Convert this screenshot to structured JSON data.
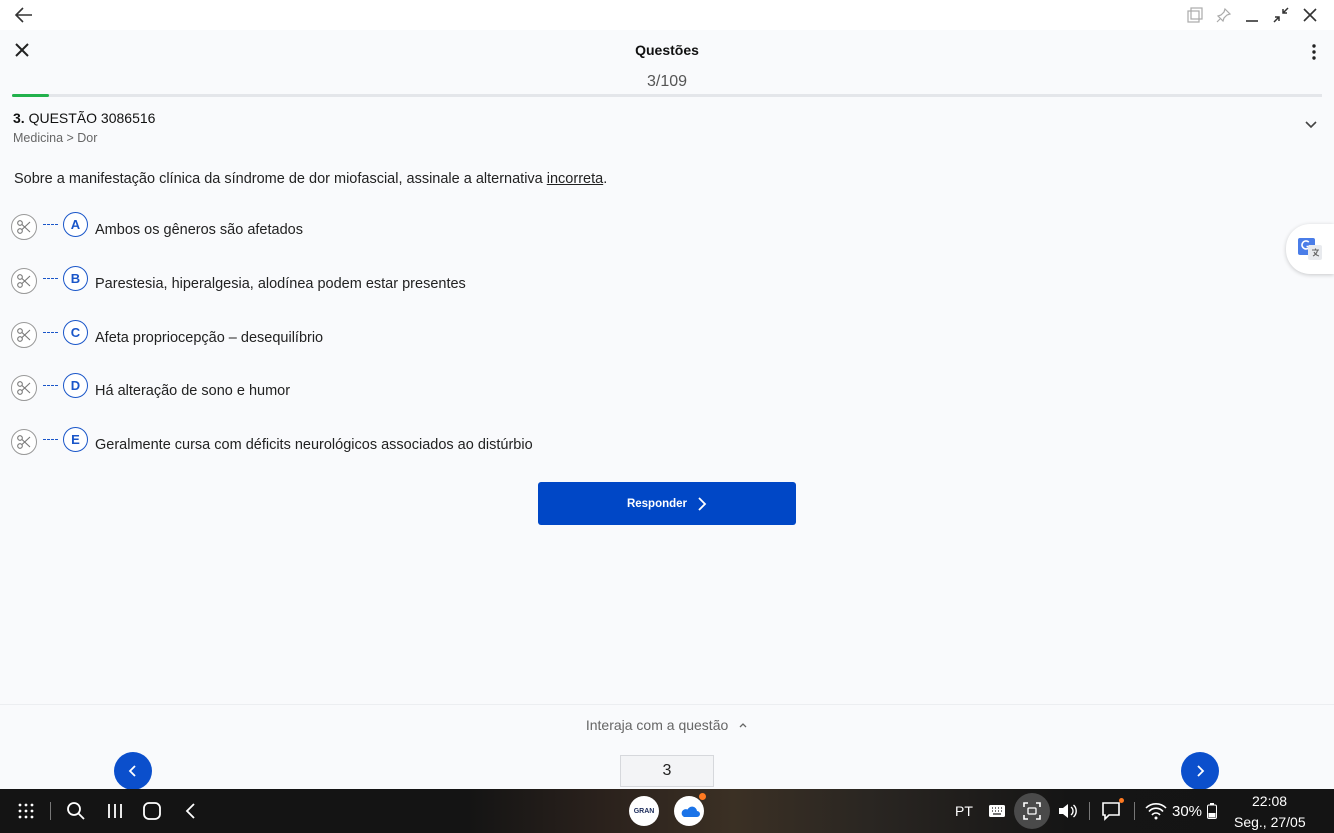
{
  "header": {
    "title": "Questões",
    "counter": "3/109",
    "progress_fraction": 0.028
  },
  "question": {
    "number": "3.",
    "label": "QUESTÃO 3086516",
    "breadcrumb": "Medicina > Dor",
    "stem_before": "Sobre a manifestação clínica da síndrome de dor miofascial, assinale a alternativa ",
    "stem_emph": "incorreta",
    "stem_after": ".",
    "options": [
      {
        "letter": "A",
        "text": "Ambos os gêneros são afetados"
      },
      {
        "letter": "B",
        "text": "Parestesia, hiperalgesia, alodínea podem estar presentes"
      },
      {
        "letter": "C",
        "text": "Afeta propriocepção – desequilíbrio"
      },
      {
        "letter": "D",
        "text": "Há alteração de sono e humor"
      },
      {
        "letter": "E",
        "text": "Geralmente cursa com déficits neurológicos associados ao distúrbio"
      }
    ]
  },
  "actions": {
    "respond_label": "Responder"
  },
  "bottom": {
    "interact_label": "Interaja com a questão",
    "page_value": "3"
  },
  "taskbar": {
    "language": "PT",
    "battery": "30%",
    "time": "22:08",
    "date": "Seg., 27/05",
    "gran_label": "GRAN"
  },
  "colors": {
    "accent": "#0047c6",
    "progress": "#22b14c"
  }
}
